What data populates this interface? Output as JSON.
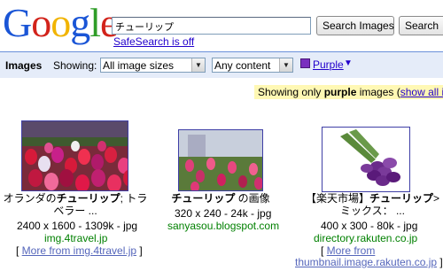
{
  "logo": {
    "letters": [
      "G",
      "o",
      "o",
      "g",
      "l",
      "e"
    ]
  },
  "search": {
    "query": "チューリップ",
    "images_button": "Search Images",
    "web_button": "Search"
  },
  "safesearch": "SafeSearch is off",
  "toolbar": {
    "title": "Images",
    "showing_label": "Showing:",
    "size_select": "All image sizes",
    "content_select": "Any content",
    "color_label": "Purple",
    "color_hex": "#7a2fbf"
  },
  "notice": {
    "prefix": "Showing only ",
    "color_word": "purple",
    "suffix": " images (",
    "link": "show all im"
  },
  "results": [
    {
      "title_a": "オランダの",
      "title_b": "チューリップ",
      "title_c": "; トラ",
      "title_d": "ベラー ...",
      "size": "2400 x 1600 - 1309k - jpg",
      "domain": "img.4travel.jp",
      "more": "More from img.4travel.jp"
    },
    {
      "title_a": "",
      "title_b": "チューリップ",
      "title_c": " の画像",
      "title_d": "",
      "size": "320 x 240 - 24k - jpg",
      "domain": "sanyasou.blogspot.com",
      "more": ""
    },
    {
      "title_a": "【楽天市場】",
      "title_b": "チューリップ",
      "title_c": ">",
      "title_d": "ミックス： ...",
      "size": "400 x 300 - 80k - jpg",
      "domain": "directory.rakuten.co.jp",
      "more_a": "More from",
      "more_b": "thumbnail.image.rakuten.co.jp"
    }
  ]
}
